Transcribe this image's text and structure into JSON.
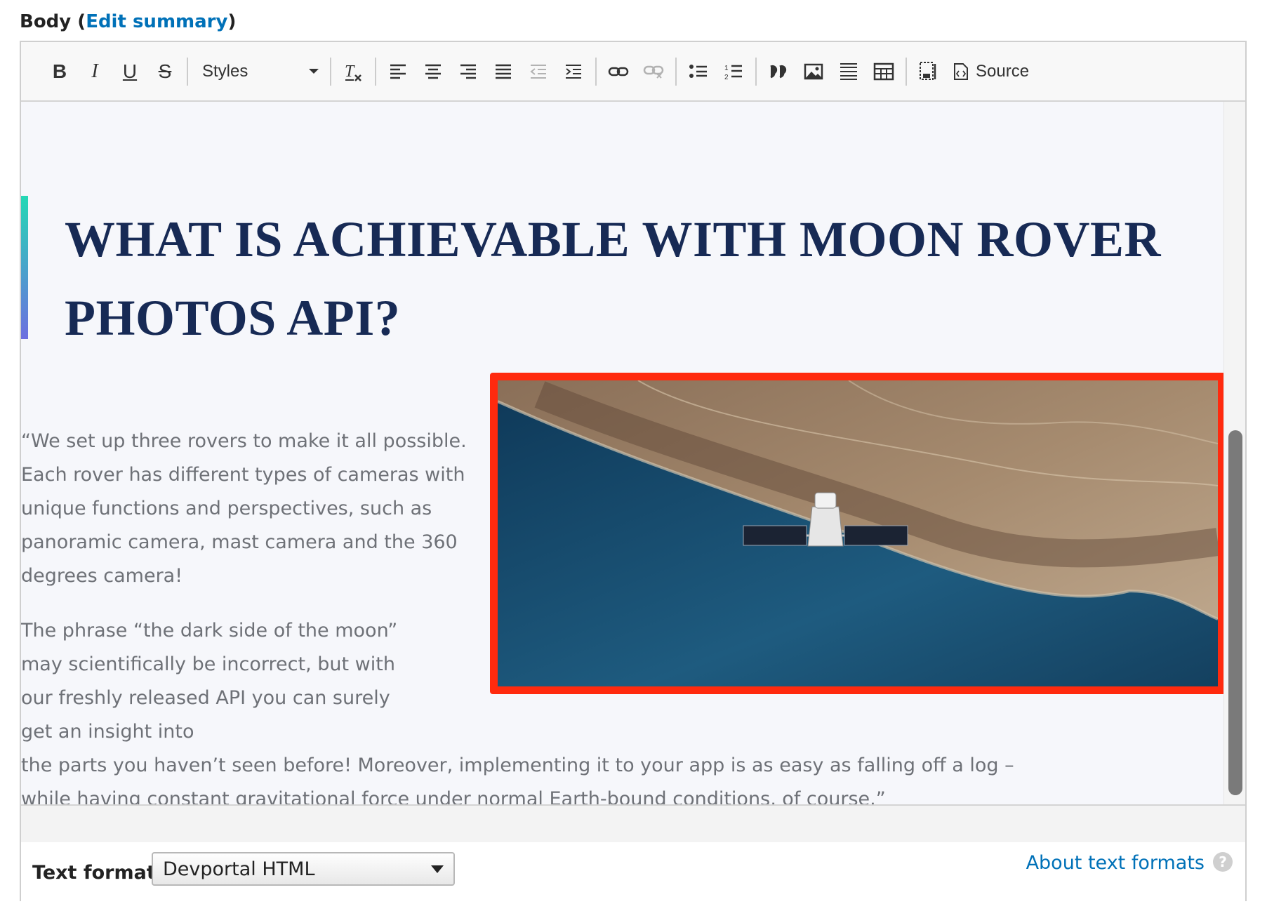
{
  "field": {
    "label": "Body",
    "paren_open": " (",
    "edit_summary_link": "Edit summary",
    "paren_close": ")"
  },
  "toolbar": {
    "bold": "B",
    "italic": "I",
    "underline": "U",
    "strike": "S",
    "styles_label": "Styles",
    "remove_format": "Tx",
    "source_label": "Source",
    "icons": [
      "bold-icon",
      "italic-icon",
      "underline-icon",
      "strikethrough-icon",
      "styles-dropdown",
      "remove-format-icon",
      "align-left-icon",
      "align-center-icon",
      "align-right-icon",
      "align-justify-icon",
      "outdent-icon",
      "indent-icon",
      "link-icon",
      "unlink-icon",
      "bulleted-list-icon",
      "numbered-list-icon",
      "blockquote-icon",
      "image-icon",
      "horizontal-rule-icon",
      "table-icon",
      "show-blocks-icon",
      "source-icon"
    ]
  },
  "content": {
    "heading": "WHAT IS ACHIEVABLE WITH MOON ROVER PHOTOS API?",
    "paragraph_1": "“We set up three rovers to make it all possible. Each rover has different types of cameras with unique functions and perspectives, such as panoramic camera, mast camera and the 360 degrees camera!",
    "paragraph_2_wrapped": "The phrase “the dark side of the moon” may scientifically be incorrect, but with our freshly released API you can surely get an insight into",
    "paragraph_2_rest": "the parts you haven’t seen before! Moreover, implementing it to your app is as easy as falling off a log – while having constant gravitational force under normal Earth-bound conditions, of course.”",
    "image_alt": "satellite over coastline",
    "image_highlight_color": "#ff2a0e"
  },
  "format": {
    "label": "Text format",
    "selected": "Devportal HTML",
    "about_link": "About text formats",
    "help_glyph": "?"
  },
  "colors": {
    "heading": "#172a55",
    "body_text": "#6e7177",
    "link": "#0071b8",
    "accent_bar_top": "#25d8b5",
    "accent_bar_bottom": "#6d6fe0"
  }
}
